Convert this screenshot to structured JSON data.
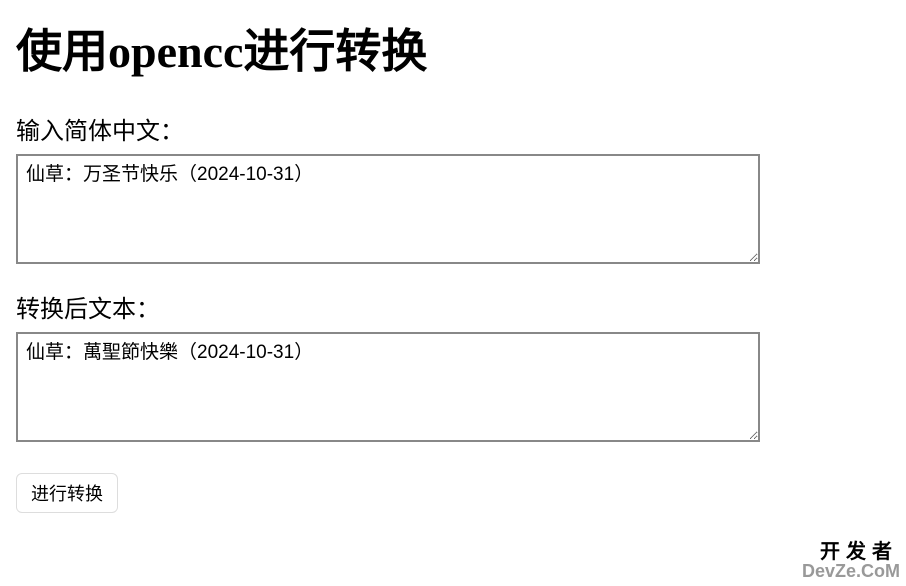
{
  "heading": "使用opencc进行转换",
  "input": {
    "label": "输入简体中文：",
    "value": "仙草：万圣节快乐（2024-10-31）"
  },
  "output": {
    "label": "转换后文本：",
    "value": "仙草：萬聖節快樂（2024-10-31）"
  },
  "button": {
    "label": "进行转换"
  },
  "watermark": {
    "line1": "开发者",
    "line2": "DevZe.CoM"
  }
}
